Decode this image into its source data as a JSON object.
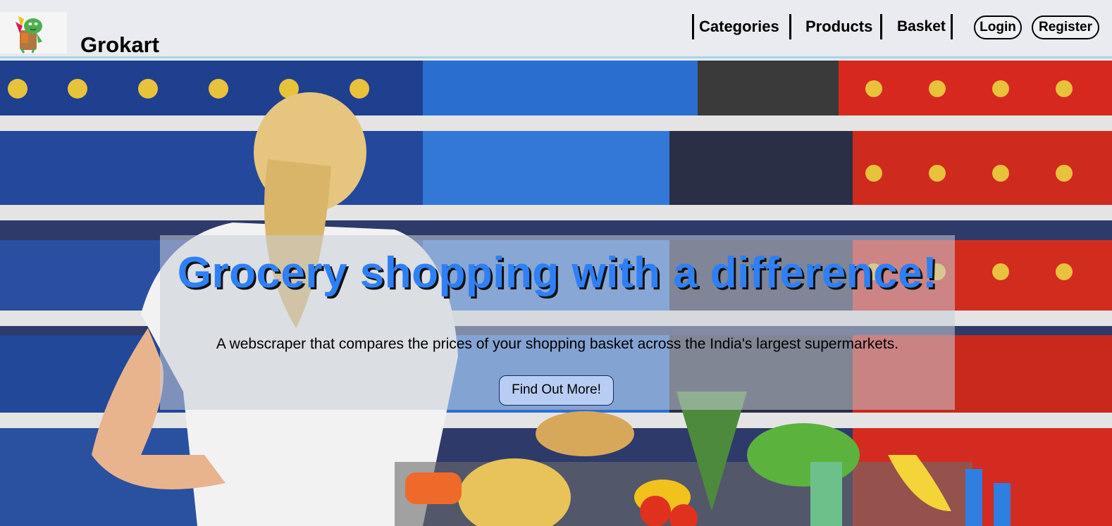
{
  "brand": {
    "name": "Grokart"
  },
  "nav": {
    "categories": "Categories",
    "products": "Products",
    "basket": "Basket",
    "login": "Login",
    "register": "Register"
  },
  "hero": {
    "title": "Grocery shopping with a difference!",
    "subtitle": "A webscraper that compares the prices of your shopping basket across the India's largest supermarkets.",
    "cta": "Find Out More!"
  },
  "colors": {
    "title": "#2f80f5",
    "navbar_bg": "#e9ebf0",
    "navbar_border": "#a8d4e6",
    "cta_bg": "#b7cdf3"
  }
}
